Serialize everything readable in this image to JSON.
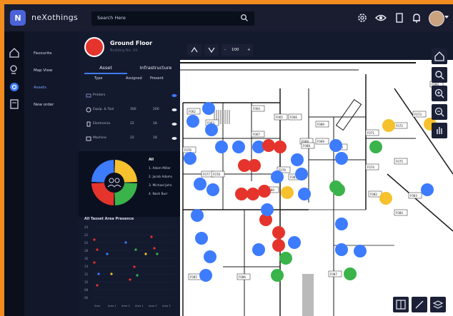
{
  "app": {
    "brand": "neXothings"
  },
  "topbar": {
    "search_placeholder": "Search Here"
  },
  "nav": {
    "items": [
      "Favourite",
      "Map View",
      "Assets",
      "New order"
    ]
  },
  "floor": {
    "title": "Ground Floor",
    "subtitle": "Building No. 24"
  },
  "tabs": [
    "Asset",
    "Infrastructure"
  ],
  "table": {
    "headers": [
      "Type",
      "Assigned",
      "Present"
    ],
    "rows": [
      {
        "type": "Printers",
        "assigned": "",
        "present": ""
      },
      {
        "type": "Equip. & Tool",
        "assigned": "300",
        "present": "200"
      },
      {
        "type": "Electronics",
        "assigned": "22",
        "present": "18"
      },
      {
        "type": "Machine",
        "assigned": "22",
        "present": "18"
      }
    ]
  },
  "donut": {
    "legend_title": "All",
    "legend": [
      "1. Adam Miller",
      "2. Jacob Adams",
      "3. Michael John",
      "4. Nash Burr"
    ],
    "colors": [
      "#f6c12d",
      "#39b34a",
      "#e5342c",
      "#3d7bff"
    ]
  },
  "scatter_panel": {
    "title": "All Tasset Area Presence",
    "y_ticks": [
      "24",
      "22",
      "20",
      "18",
      "16",
      "14",
      "12",
      "10",
      "08",
      "06"
    ],
    "x_ticks": [
      "Area",
      "Area 1",
      "Area 2",
      "Area 1",
      "Area 2",
      "Area 3"
    ]
  },
  "map": {
    "zoom_label": "100",
    "rooms": [
      "F062",
      "F063",
      "F064",
      "F065",
      "F066",
      "F067",
      "F068",
      "F069",
      "F070",
      "F071",
      "F072",
      "F073",
      "F074",
      "F075",
      "F076",
      "F077",
      "F078",
      "F079",
      "F080",
      "F081",
      "F082",
      "F083",
      "F084",
      "F085",
      "F086",
      "F087",
      "F088",
      "F089",
      "F090"
    ]
  },
  "colors": {
    "accent": "#3d7bff",
    "red": "#e5342c",
    "green": "#39b34a",
    "yellow": "#f6c12d",
    "frame": "#f28c1e"
  }
}
